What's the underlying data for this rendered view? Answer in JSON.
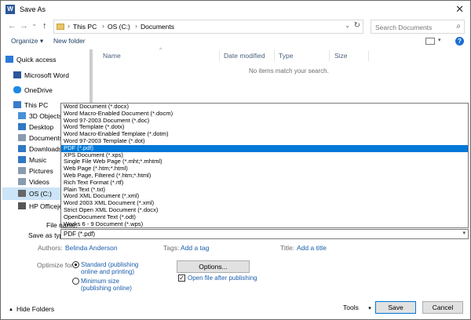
{
  "title_bar": {
    "app_icon": "word-icon",
    "title": "Save As",
    "close_glyph": "✕"
  },
  "nav": {
    "back": "←",
    "forward": "→",
    "dropdown": "⌄",
    "up": "↑"
  },
  "address": {
    "crumbs": [
      "This PC",
      "OS (C:)",
      "Documents"
    ],
    "separator": "›",
    "dropdown": "⌄",
    "refresh": "↻"
  },
  "search": {
    "placeholder": "Search Documents",
    "icon": "⌕"
  },
  "toolbar": {
    "organize_label": "Organize ▾",
    "new_folder_label": "New folder",
    "help_glyph": "?",
    "view_dropdown": "▾"
  },
  "sidebar": {
    "items": [
      {
        "label": "Quick access",
        "icon": "star-icon",
        "color": "#2b7bd6"
      },
      {
        "label": "Microsoft Word",
        "icon": "word-icon",
        "color": "#2b579a"
      },
      {
        "label": "OneDrive",
        "icon": "cloud-icon",
        "color": "#1e88e5"
      },
      {
        "label": "This PC",
        "icon": "computer-icon",
        "color": "#3a7bc8"
      },
      {
        "label": "3D Objects",
        "icon": "cube-icon",
        "color": "#4a90d9"
      },
      {
        "label": "Desktop",
        "icon": "desktop-icon",
        "color": "#2f78c4"
      },
      {
        "label": "Documents",
        "icon": "documents-icon",
        "color": "#8a9bb0"
      },
      {
        "label": "Downloads",
        "icon": "download-icon",
        "color": "#2f78c4"
      },
      {
        "label": "Music",
        "icon": "music-icon",
        "color": "#2f78c4"
      },
      {
        "label": "Pictures",
        "icon": "pictures-icon",
        "color": "#8a9bb0"
      },
      {
        "label": "Videos",
        "icon": "videos-icon",
        "color": "#8a9bb0"
      },
      {
        "label": "OS (C:)",
        "icon": "drive-icon",
        "color": "#666666"
      },
      {
        "label": "HP Officejet 6",
        "icon": "printer-icon",
        "color": "#555555"
      }
    ]
  },
  "columns": [
    {
      "label": "Name"
    },
    {
      "label": "Date modified"
    },
    {
      "label": "Type"
    },
    {
      "label": "Size"
    }
  ],
  "sort_caret": "^",
  "empty_message": "No items match your search.",
  "save_as_type": {
    "options": [
      "Word Document (*.docx)",
      "Word Macro-Enabled Document (*.docm)",
      "Word 97-2003 Document (*.doc)",
      "Word Template (*.dotx)",
      "Word Macro-Enabled Template (*.dotm)",
      "Word 97-2003 Template (*.dot)",
      "PDF (*.pdf)",
      "XPS Document (*.xps)",
      "Single File Web Page (*.mht;*.mhtml)",
      "Web Page (*.htm;*.html)",
      "Web Page, Filtered (*.htm;*.html)",
      "Rich Text Format (*.rtf)",
      "Plain Text (*.txt)",
      "Word XML Document (*.xml)",
      "Word 2003 XML Document (*.xml)",
      "Strict Open XML Document (*.docx)",
      "OpenDocument Text (*.odt)",
      "Works 6 - 9 Document (*.wps)"
    ],
    "selected": "PDF (*.pdf)",
    "selected_index": 6,
    "dropdown": "▾"
  },
  "labels": {
    "file_name": "File name:",
    "save_as_type": "Save as type:",
    "authors": "Authors:",
    "tags": "Tags:",
    "title": "Title:",
    "optimize_for": "Optimize for:"
  },
  "meta": {
    "authors_value": "Belinda Anderson",
    "tags_value": "Add a tag",
    "title_value": "Add a title"
  },
  "optimize": {
    "standard_line1": "Standard (publishing",
    "standard_line2": "online and printing)",
    "minimum_line1": "Minimum size",
    "minimum_line2": "(publishing online)",
    "selected": "standard"
  },
  "options_button": "Options...",
  "open_after": {
    "label": "Open file after publishing",
    "checked": true,
    "check_glyph": "✓"
  },
  "footer": {
    "hide_folders": "Hide Folders",
    "hide_caret": "▲",
    "tools": "Tools",
    "tools_caret": "▾",
    "save": "Save",
    "cancel": "Cancel"
  },
  "colors": {
    "accent": "#0078d7",
    "link": "#1a5dab",
    "selection": "#0078d7"
  }
}
